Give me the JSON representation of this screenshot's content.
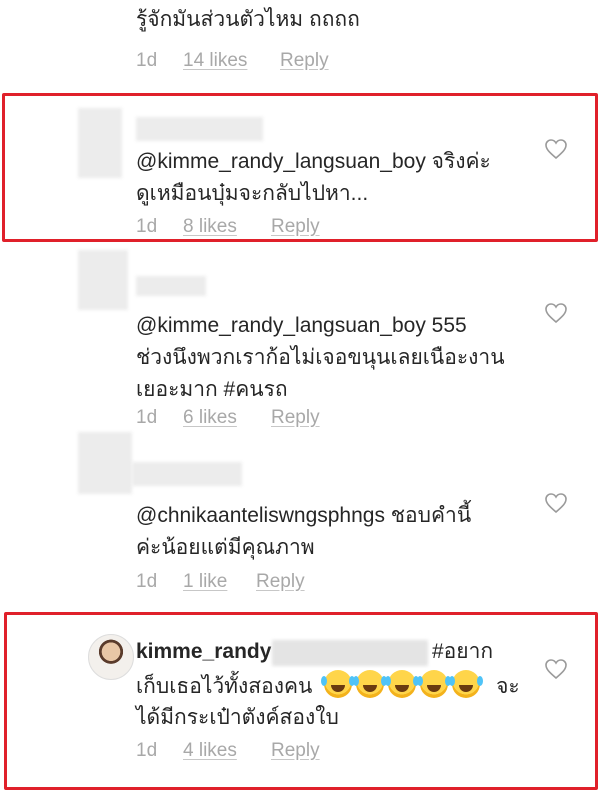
{
  "comments": [
    {
      "text": "รู้จักมันส่วนตัวไหม ถถถถ",
      "time": "1d",
      "likes": "14 likes",
      "reply": "Reply"
    },
    {
      "text_line1": "@kimme_randy_langsuan_boy จริงค่ะ",
      "text_line2": "ดูเหมือนบุ๋มจะกลับไปหา...",
      "time": "1d",
      "likes": "8 likes",
      "reply": "Reply"
    },
    {
      "text_line1": "@kimme_randy_langsuan_boy 555",
      "text_line2": "ช่วงนึงพวกเราก้อไม่เจอขนุนเลยเนือะงาน",
      "text_line3": "เยอะมาก #คนรถ",
      "time": "1d",
      "likes": "6 likes",
      "reply": "Reply"
    },
    {
      "text_line1": "@chnikaanteliswngsphngs ชอบคำนี้",
      "text_line2": "ค่ะน้อยแต่มีคุณภาพ",
      "time": "1d",
      "likes": "1 like",
      "reply": "Reply"
    },
    {
      "username": "kimme_randy",
      "hashtag": "#อยาก",
      "text_line2a": "เก็บเธอไว้ทั้งสองคน",
      "text_line2b": "จะ",
      "text_line3": "ได้มีกระเป๋าตังค์สองใบ",
      "time": "1d",
      "likes": "4 likes",
      "reply": "Reply"
    }
  ],
  "icons": {
    "like": "heart-outline-icon",
    "avatar": "user-avatar",
    "emoji": "laughing-tears-emoji"
  },
  "colors": {
    "highlight": "#e0202a",
    "meta": "#a8a8a8",
    "text": "#262626"
  }
}
